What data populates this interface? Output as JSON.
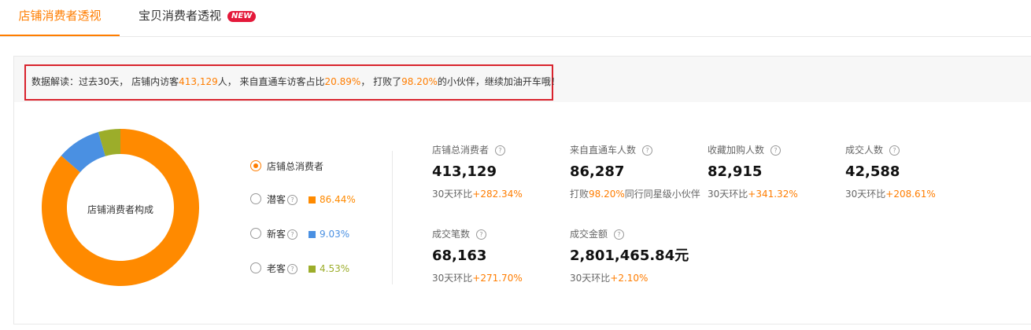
{
  "tabs": [
    {
      "label": "店铺消费者透视",
      "active": true
    },
    {
      "label": "宝贝消费者透视",
      "badge": "NEW"
    }
  ],
  "summary": {
    "prefix": "数据解读：过去30天， 店铺内访客",
    "visitors": "413,129",
    "mid1": "人， 来自直通车访客占比",
    "share": "20.89%",
    "mid2": "， 打败了",
    "beat": "98.20%",
    "suffix": "的小伙伴，继续加油开车哦！"
  },
  "donut": {
    "center_label": "店铺消费者构成",
    "segments": [
      {
        "name": "潜客",
        "value": 86.44,
        "color": "#ff8a00"
      },
      {
        "name": "新客",
        "value": 9.03,
        "color": "#4a90e2"
      },
      {
        "name": "老客",
        "value": 4.53,
        "color": "#9cad2a"
      }
    ]
  },
  "legend": [
    {
      "label": "店铺总消费者",
      "selected": true
    },
    {
      "label": "潜客",
      "pct": "86.44%",
      "color": "#ff8a00",
      "help": "?"
    },
    {
      "label": "新客",
      "pct": "9.03%",
      "color": "#4a90e2",
      "help": "?"
    },
    {
      "label": "老客",
      "pct": "4.53%",
      "color": "#9cad2a",
      "help": "?"
    }
  ],
  "metrics": [
    {
      "title": "店铺总消费者",
      "value": "413,129",
      "sub_prefix": "30天环比",
      "sub_hl": "+282.34%",
      "sub_suffix": ""
    },
    {
      "title": "来自直通车人数",
      "value": "86,287",
      "sub_prefix": "打败",
      "sub_hl": "98.20%",
      "sub_suffix": "同行同星级小伙伴"
    },
    {
      "title": "收藏加购人数",
      "value": "82,915",
      "sub_prefix": "30天环比",
      "sub_hl": "+341.32%",
      "sub_suffix": ""
    },
    {
      "title": "成交人数",
      "value": "42,588",
      "sub_prefix": "30天环比",
      "sub_hl": "+208.61%",
      "sub_suffix": ""
    },
    {
      "title": "成交笔数",
      "value": "68,163",
      "sub_prefix": "30天环比",
      "sub_hl": "+271.70%",
      "sub_suffix": ""
    },
    {
      "title": "成交金额",
      "value": "2,801,465.84元",
      "sub_prefix": "30天环比",
      "sub_hl": "+2.10%",
      "sub_suffix": ""
    }
  ],
  "help_glyph": "?"
}
